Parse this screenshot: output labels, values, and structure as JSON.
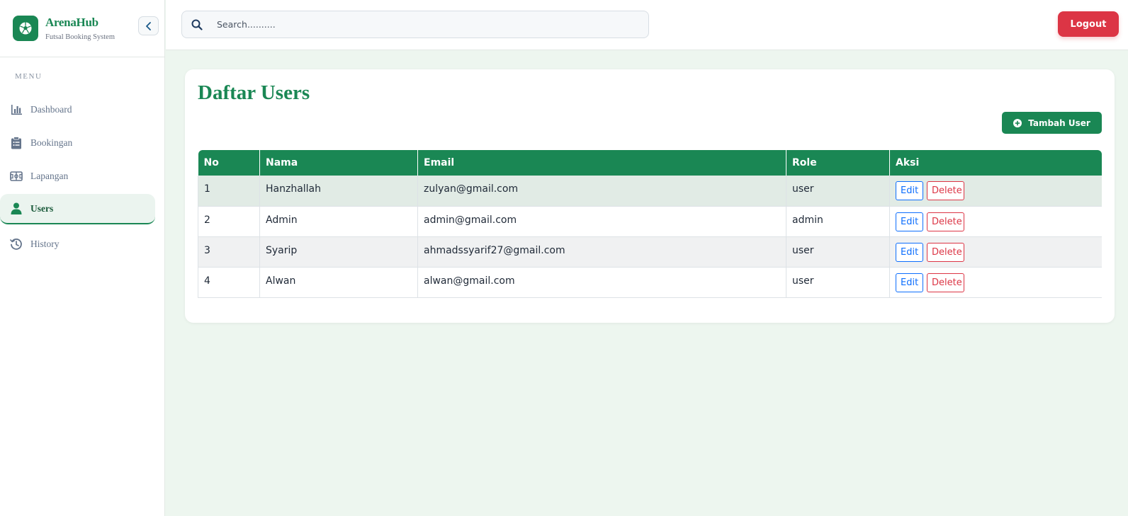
{
  "brand": {
    "title": "ArenaHub",
    "subtitle": "Futsal Booking System",
    "logo_icon": "soccer-ball-icon",
    "color": "#1a8754"
  },
  "sidebar": {
    "menu_label": "MENU",
    "items": [
      {
        "label": "Dashboard",
        "icon": "bar-chart-icon",
        "active": false
      },
      {
        "label": "Bookingan",
        "icon": "clipboard-icon",
        "active": false
      },
      {
        "label": "Lapangan",
        "icon": "field-icon",
        "active": false
      },
      {
        "label": "Users",
        "icon": "user-icon",
        "active": true
      },
      {
        "label": "History",
        "icon": "history-icon",
        "active": false
      }
    ]
  },
  "topbar": {
    "search_placeholder": "Search..........",
    "logout_label": "Logout"
  },
  "main": {
    "title": "Daftar Users",
    "add_button_label": "Tambah User",
    "table": {
      "headers": [
        "No",
        "Nama",
        "Email",
        "Role",
        "Aksi"
      ],
      "rows": [
        {
          "no": "1",
          "nama": "Hanzhallah",
          "email": "zulyan@gmail.com",
          "role": "user"
        },
        {
          "no": "2",
          "nama": "Admin",
          "email": "admin@gmail.com",
          "role": "admin"
        },
        {
          "no": "3",
          "nama": "Syarip",
          "email": "ahmadssyarif27@gmail.com",
          "role": "user"
        },
        {
          "no": "4",
          "nama": "Alwan",
          "email": "alwan@gmail.com",
          "role": "user"
        }
      ],
      "edit_label": "Edit",
      "delete_label": "Delete"
    }
  },
  "colors": {
    "primary": "#1a8754",
    "danger": "#dc3545",
    "edit": "#0d6efd",
    "background": "#edf6ef"
  }
}
